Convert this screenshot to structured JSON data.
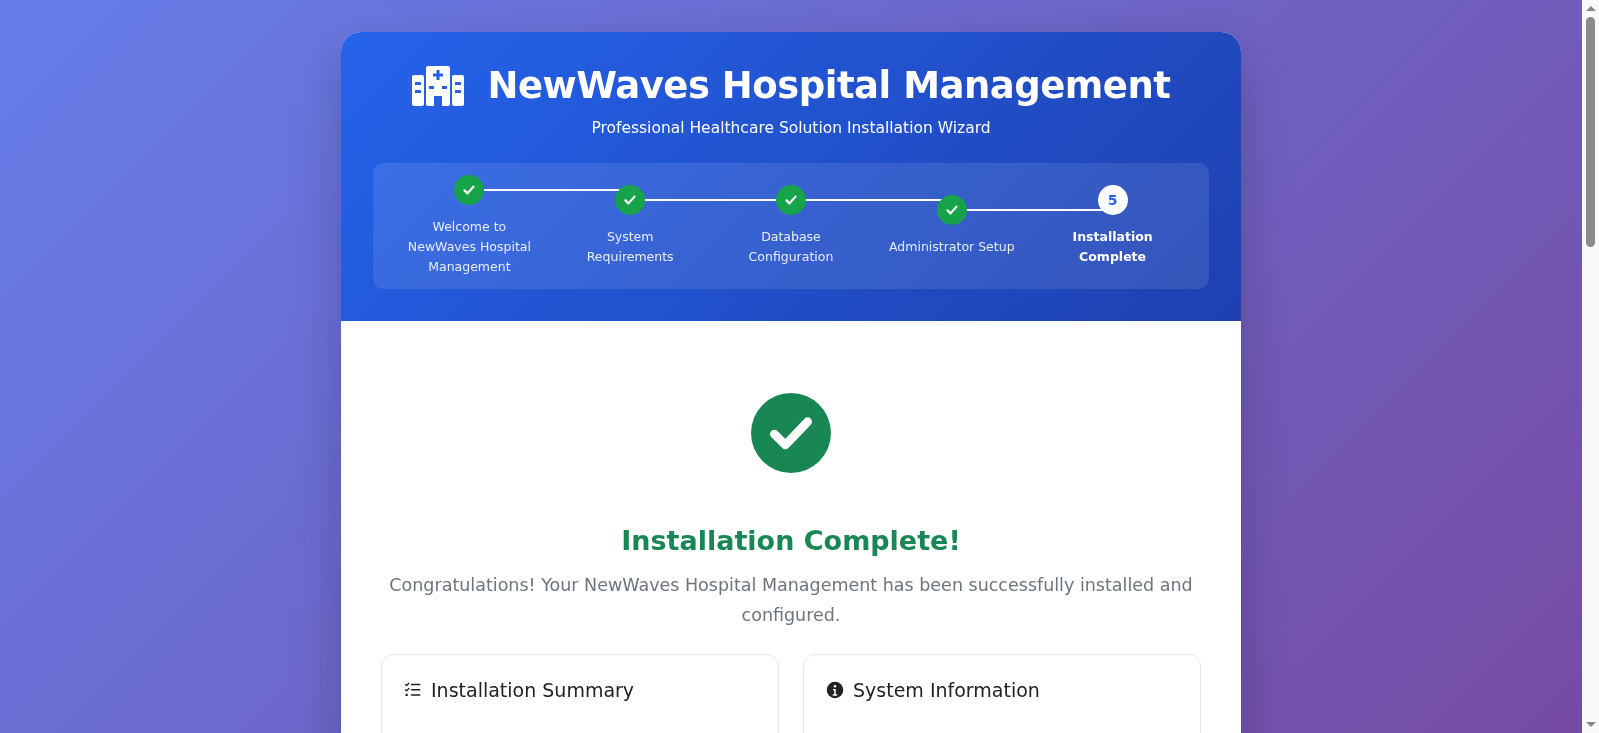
{
  "header": {
    "title": "NewWaves Hospital Management",
    "subtitle": "Professional Healthcare Solution Installation Wizard"
  },
  "steps": [
    {
      "label": "Welcome to NewWaves Hospital Management",
      "completed": true,
      "selected": false
    },
    {
      "label": "System Requirements",
      "completed": true,
      "selected": false
    },
    {
      "label": "Database Configuration",
      "completed": true,
      "selected": false
    },
    {
      "label": "Administrator Setup",
      "completed": true,
      "selected": false
    },
    {
      "label": "Installation Complete",
      "number": "5",
      "completed": false,
      "selected": true
    }
  ],
  "result": {
    "title": "Installation Complete!",
    "message": "Congratulations! Your NewWaves Hospital Management has been successfully installed and configured."
  },
  "cards": [
    {
      "title": "Installation Summary",
      "kind": "checklist"
    },
    {
      "title": "System Information",
      "kind": "info"
    }
  ]
}
